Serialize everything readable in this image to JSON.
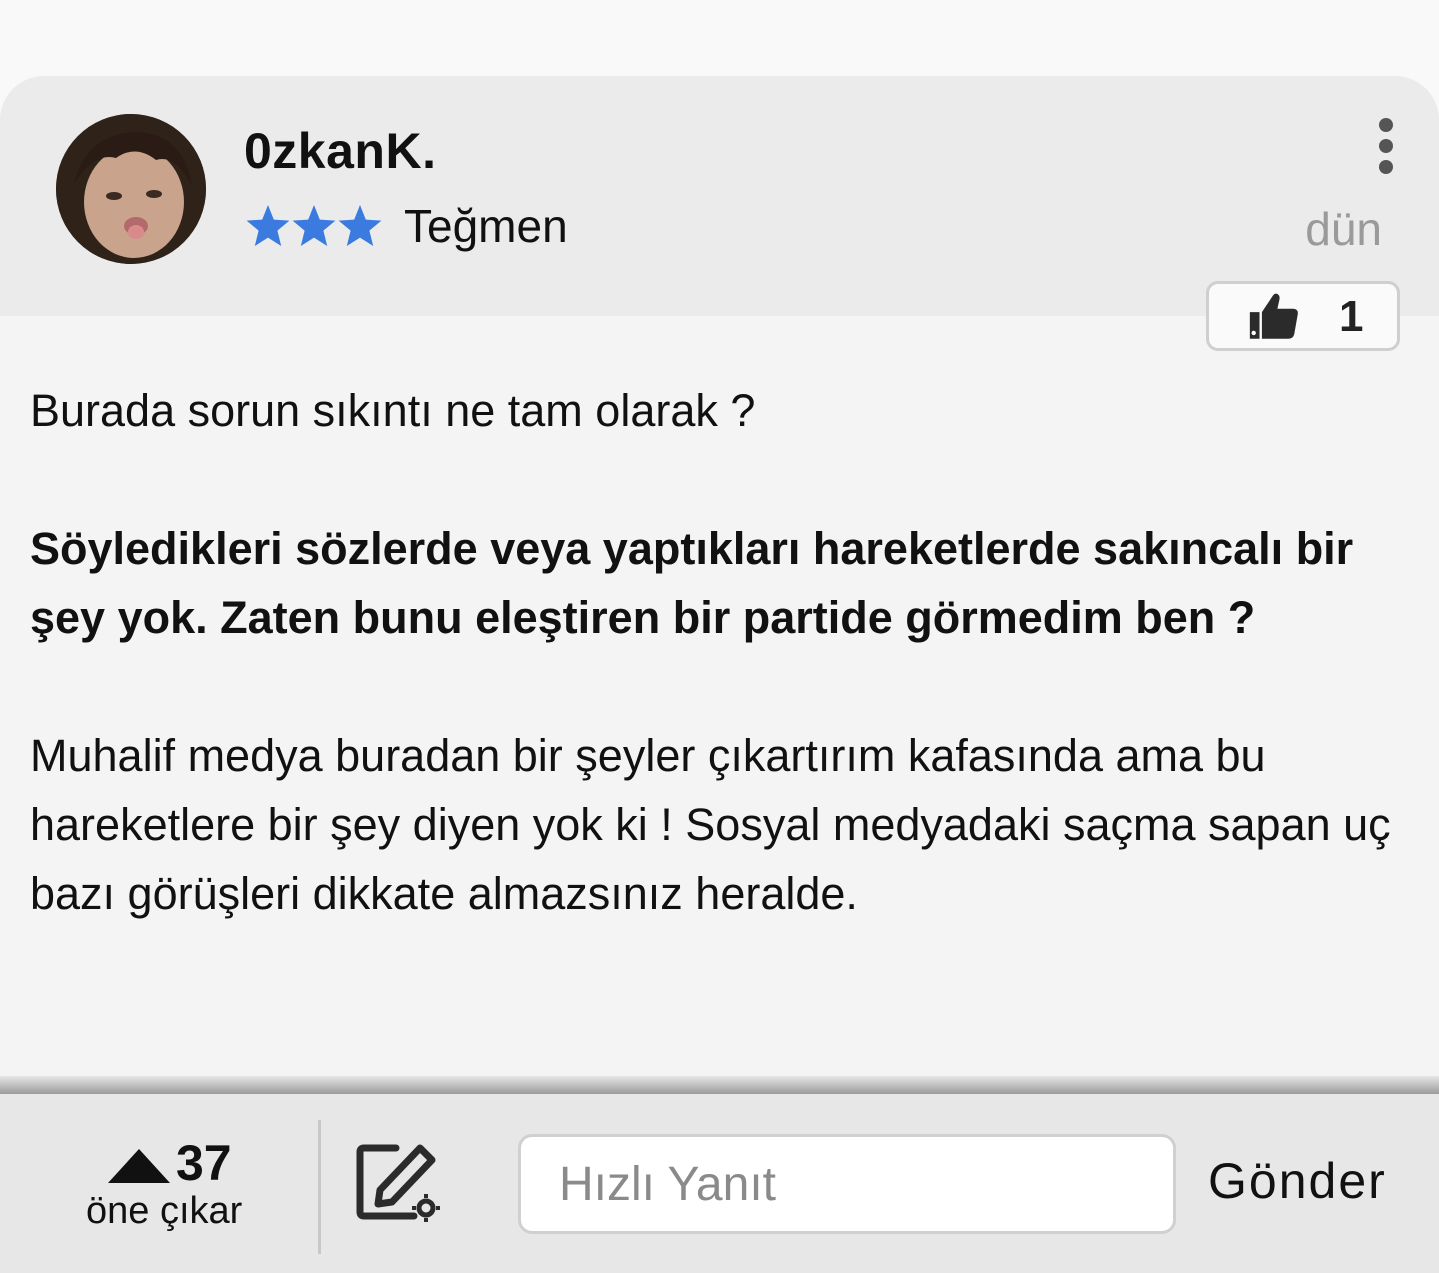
{
  "post": {
    "author": {
      "name": "0zkanK.",
      "rank": "Teğmen",
      "star_count": 3,
      "star_color": "#3b7be0"
    },
    "time": "dün",
    "likes": "1",
    "paragraphs": [
      "Burada sorun sıkıntı ne tam olarak ?",
      "Söyledikleri sözlerde veya yaptıkları hareketlerde sakıncalı bir şey yok. Zaten bunu eleştiren bir partide görmedim ben ?",
      "Muhalif medya buradan bir şeyler çıkartırım kafasında ama bu hareketlere bir şey diyen yok ki ! Sosyal medyadaki saçma sapan uç bazı görüşleri dikkate almazsınız heralde."
    ]
  },
  "bottom_bar": {
    "upvote_count": "37",
    "upvote_label": "öne çıkar",
    "reply_placeholder": "Hızlı Yanıt",
    "reply_value": "",
    "send_label": "Gönder"
  },
  "icons": {
    "more": "more-vertical-icon",
    "like": "thumbs-up-icon",
    "upvote": "triangle-up-icon",
    "compose": "edit-settings-icon",
    "star": "star-icon"
  }
}
